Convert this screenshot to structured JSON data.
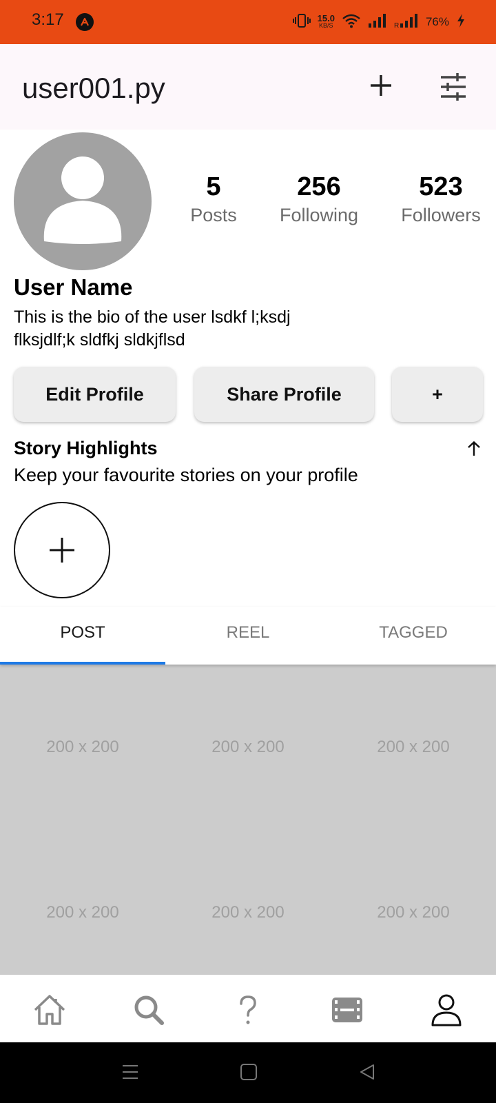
{
  "status_bar": {
    "time": "3:17",
    "net_speed_value": "15.0",
    "net_speed_unit": "KB/S",
    "battery": "76%",
    "bg_color": "#e84a13"
  },
  "header": {
    "title": "user001.py",
    "add_icon": "plus-icon",
    "settings_icon": "tune-icon",
    "bg_color": "#fdf7fb"
  },
  "profile": {
    "avatar_icon": "person-placeholder-icon",
    "stats": [
      {
        "value": "5",
        "label": "Posts"
      },
      {
        "value": "256",
        "label": "Following"
      },
      {
        "value": "523",
        "label": "Followers"
      }
    ],
    "name": "User Name",
    "bio": "This is the bio of the user lsdkf l;ksdj flksjdlf;k sldfkj sldkjflsd"
  },
  "actions": {
    "edit_label": "Edit Profile",
    "share_label": "Share Profile",
    "more_label": "+"
  },
  "highlights": {
    "title": "Story Highlights",
    "subtitle": "Keep your favourite stories on your profile",
    "collapse_icon": "arrow-up-icon",
    "new_icon": "plus-icon"
  },
  "tabs": {
    "items": [
      {
        "label": "POST",
        "active": true
      },
      {
        "label": "REEL",
        "active": false
      },
      {
        "label": "TAGGED",
        "active": false
      }
    ],
    "indicator_color": "#1e7ae6"
  },
  "grid": {
    "placeholders": [
      "200 x 200",
      "200 x 200",
      "200 x 200",
      "200 x 200",
      "200 x 200",
      "200 x 200"
    ]
  },
  "bottom_nav": {
    "items": [
      "home-icon",
      "search-icon",
      "help-icon",
      "reels-icon",
      "profile-icon"
    ]
  },
  "system_nav": {
    "items": [
      "menu-icon",
      "home-square-icon",
      "back-icon"
    ]
  }
}
